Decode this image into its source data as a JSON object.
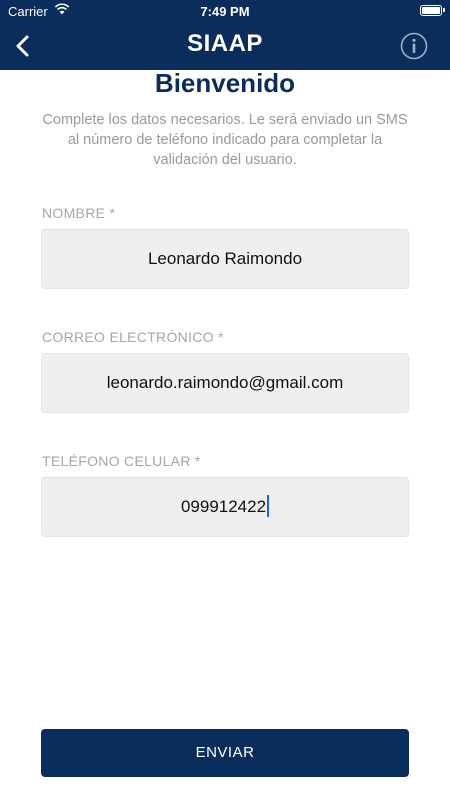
{
  "status_bar": {
    "carrier": "Carrier",
    "time": "7:49 PM"
  },
  "nav": {
    "title": "SIAAP",
    "back_icon": "chevron-left-icon",
    "info_icon": "info-icon"
  },
  "content": {
    "heading": "Bienvenido",
    "intro": "Complete los datos necesarios. Le será enviado un SMS al número de teléfono indicado para completar la validación del usuario."
  },
  "form": {
    "name": {
      "label": "NOMBRE *",
      "value": "Leonardo Raimondo"
    },
    "email": {
      "label": "CORREO ELECTRÓNICO *",
      "value": "leonardo.raimondo@gmail.com"
    },
    "phone": {
      "label": "TELÉFONO CELULAR *",
      "value": "099912422"
    }
  },
  "actions": {
    "send_label": "ENVIAR"
  },
  "colors": {
    "primary": "#0b2d5b",
    "field_bg": "#efefef",
    "label": "#a6a6a6",
    "caret": "#1e63e6"
  }
}
